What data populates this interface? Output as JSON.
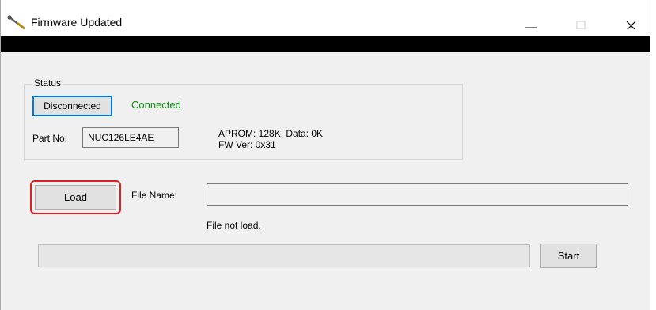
{
  "window": {
    "title": "Firmware Updated",
    "icons": {
      "app": "wrench-screwdriver-icon",
      "minimize": "minimize-icon",
      "maximize": "maximize-icon",
      "close": "close-icon"
    }
  },
  "status_group": {
    "label": "Status",
    "disconnect_button": "Disconnected",
    "connection_state": "Connected",
    "connection_color": "#0a8f0a",
    "part_no_label": "Part No.",
    "part_no_value": "NUC126LE4AE",
    "memory_info": "APROM: 128K, Data: 0K",
    "fw_version": "FW Ver: 0x31"
  },
  "file_section": {
    "load_button": "Load",
    "file_name_label": "File Name:",
    "file_name_value": "",
    "status_message": "File not load.",
    "highlight_color": "#e02020"
  },
  "progress": {
    "value": 0
  },
  "start_button": "Start"
}
